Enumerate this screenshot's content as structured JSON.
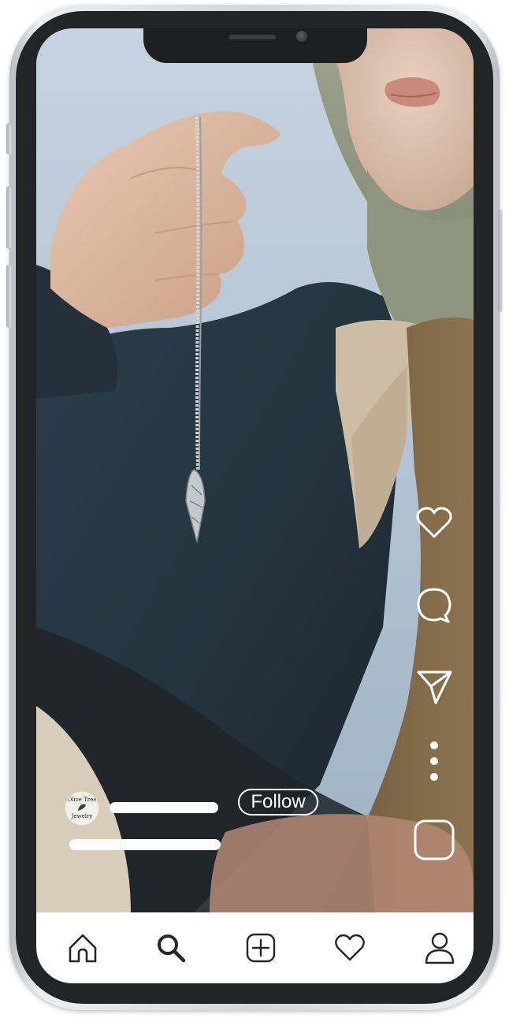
{
  "post": {
    "avatar_brand_top": "Olive Tree",
    "avatar_brand_bottom": "Jewelry",
    "follow_label": "Follow"
  },
  "actions": {
    "like_icon": "heart-icon",
    "comment_icon": "comment-icon",
    "share_icon": "send-icon",
    "more_icon": "more-vertical-icon",
    "audio_icon": "audio-thumbnail-icon"
  },
  "nav": {
    "items": [
      "home-icon",
      "search-icon",
      "add-post-icon",
      "activity-heart-icon",
      "profile-icon"
    ]
  },
  "colors": {
    "overlay_icon": "#ffffff",
    "nav_icon": "#262626",
    "nav_background": "#ffffff"
  }
}
